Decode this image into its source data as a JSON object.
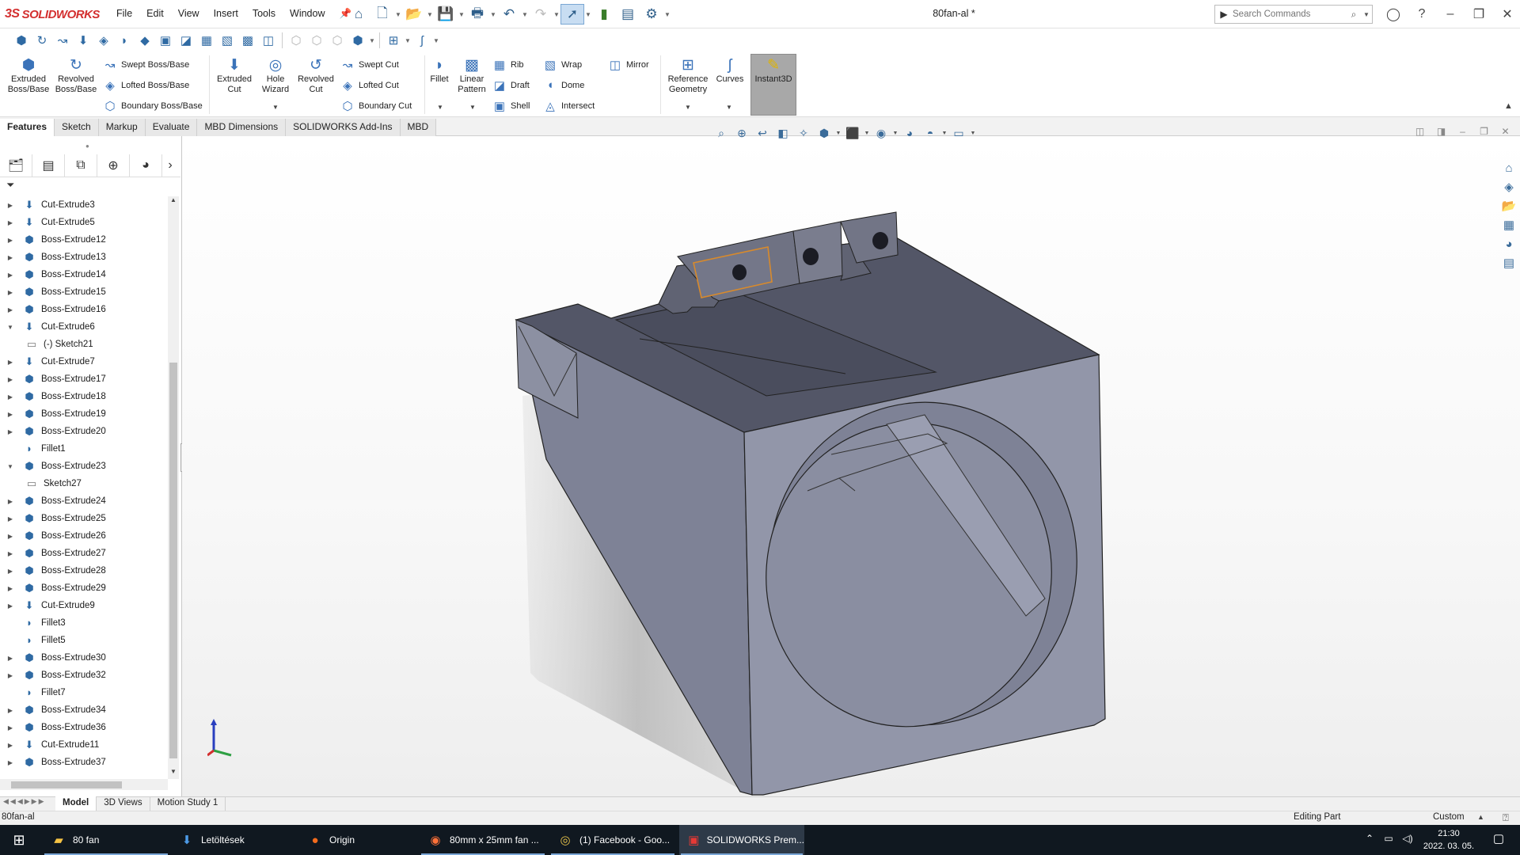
{
  "app": {
    "brand": "SOLIDWORKS",
    "brand_mark": "3S",
    "doc_title": "80fan-al *"
  },
  "menu": [
    "File",
    "Edit",
    "View",
    "Insert",
    "Tools",
    "Window"
  ],
  "search": {
    "placeholder": "Search Commands"
  },
  "ribbon": {
    "extruded_boss": [
      "Extruded",
      "Boss/Base"
    ],
    "revolved_boss": [
      "Revolved",
      "Boss/Base"
    ],
    "swept_boss": "Swept Boss/Base",
    "lofted_boss": "Lofted Boss/Base",
    "boundary_boss": "Boundary Boss/Base",
    "extruded_cut": [
      "Extruded",
      "Cut"
    ],
    "hole_wizard": [
      "Hole",
      "Wizard"
    ],
    "revolved_cut": [
      "Revolved",
      "Cut"
    ],
    "swept_cut": "Swept Cut",
    "lofted_cut": "Lofted Cut",
    "boundary_cut": "Boundary Cut",
    "fillet": "Fillet",
    "linear_pattern": [
      "Linear",
      "Pattern"
    ],
    "rib": "Rib",
    "draft": "Draft",
    "shell": "Shell",
    "wrap": "Wrap",
    "dome": "Dome",
    "intersect": "Intersect",
    "mirror": "Mirror",
    "reference_geometry": [
      "Reference",
      "Geometry"
    ],
    "curves": "Curves",
    "instant3d": "Instant3D"
  },
  "tabs": [
    "Features",
    "Sketch",
    "Markup",
    "Evaluate",
    "MBD Dimensions",
    "SOLIDWORKS Add-Ins",
    "MBD"
  ],
  "active_tab": "Features",
  "tree": [
    {
      "label": "Cut-Extrude3",
      "kind": "feature",
      "expanded": false
    },
    {
      "label": "Cut-Extrude5",
      "kind": "feature",
      "expanded": false
    },
    {
      "label": "Boss-Extrude12",
      "kind": "feature",
      "expanded": false
    },
    {
      "label": "Boss-Extrude13",
      "kind": "feature",
      "expanded": false
    },
    {
      "label": "Boss-Extrude14",
      "kind": "feature",
      "expanded": false
    },
    {
      "label": "Boss-Extrude15",
      "kind": "feature",
      "expanded": false
    },
    {
      "label": "Boss-Extrude16",
      "kind": "feature",
      "expanded": false
    },
    {
      "label": "Cut-Extrude6",
      "kind": "feature",
      "expanded": true
    },
    {
      "label": "(-) Sketch21",
      "kind": "sketch",
      "expanded": null
    },
    {
      "label": "Cut-Extrude7",
      "kind": "feature",
      "expanded": false
    },
    {
      "label": "Boss-Extrude17",
      "kind": "feature",
      "expanded": false
    },
    {
      "label": "Boss-Extrude18",
      "kind": "feature",
      "expanded": false
    },
    {
      "label": "Boss-Extrude19",
      "kind": "feature",
      "expanded": false
    },
    {
      "label": "Boss-Extrude20",
      "kind": "feature",
      "expanded": false
    },
    {
      "label": "Fillet1",
      "kind": "fillet",
      "expanded": null
    },
    {
      "label": "Boss-Extrude23",
      "kind": "feature",
      "expanded": true
    },
    {
      "label": "Sketch27",
      "kind": "sketch",
      "expanded": null
    },
    {
      "label": "Boss-Extrude24",
      "kind": "feature",
      "expanded": false
    },
    {
      "label": "Boss-Extrude25",
      "kind": "feature",
      "expanded": false
    },
    {
      "label": "Boss-Extrude26",
      "kind": "feature",
      "expanded": false
    },
    {
      "label": "Boss-Extrude27",
      "kind": "feature",
      "expanded": false
    },
    {
      "label": "Boss-Extrude28",
      "kind": "feature",
      "expanded": false
    },
    {
      "label": "Boss-Extrude29",
      "kind": "feature",
      "expanded": false
    },
    {
      "label": "Cut-Extrude9",
      "kind": "feature",
      "expanded": false
    },
    {
      "label": "Fillet3",
      "kind": "fillet",
      "expanded": null
    },
    {
      "label": "Fillet5",
      "kind": "fillet",
      "expanded": null
    },
    {
      "label": "Boss-Extrude30",
      "kind": "feature",
      "expanded": false
    },
    {
      "label": "Boss-Extrude32",
      "kind": "feature",
      "expanded": false
    },
    {
      "label": "Fillet7",
      "kind": "fillet",
      "expanded": null
    },
    {
      "label": "Boss-Extrude34",
      "kind": "feature",
      "expanded": false
    },
    {
      "label": "Boss-Extrude36",
      "kind": "feature",
      "expanded": false
    },
    {
      "label": "Cut-Extrude11",
      "kind": "feature",
      "expanded": false
    },
    {
      "label": "Boss-Extrude37",
      "kind": "feature",
      "expanded": false
    }
  ],
  "bottom_tabs": [
    "Model",
    "3D Views",
    "Motion Study 1"
  ],
  "active_bottom_tab": "Model",
  "status": {
    "doc": "80fan-al",
    "mode": "Editing Part",
    "units": "Custom"
  },
  "taskbar": {
    "apps": [
      "80 fan",
      "Letöltések",
      "Origin",
      "80mm x 25mm fan ...",
      "(1) Facebook - Goo...",
      "SOLIDWORKS Prem..."
    ],
    "time": "21:30",
    "date": "2022. 03. 05."
  },
  "colors": {
    "accent": "#3b73b9",
    "brand": "#d32f2f",
    "model_face": "#8e92a4",
    "model_top": "#525566",
    "taskbar": "#101820"
  }
}
